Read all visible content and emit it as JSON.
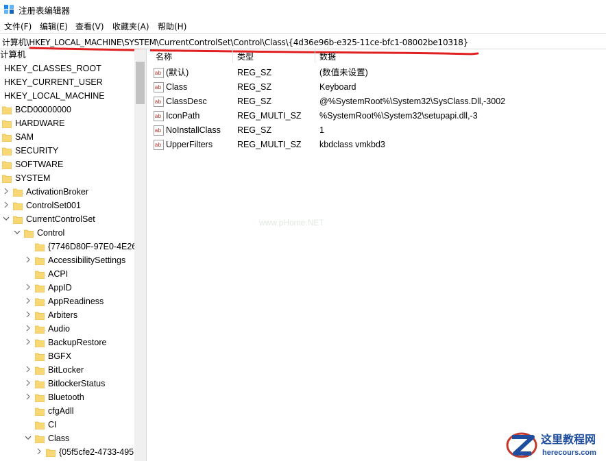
{
  "window": {
    "title": "注册表编辑器"
  },
  "menu": [
    "文件(F)",
    "编辑(E)",
    "查看(V)",
    "收藏夹(A)",
    "帮助(H)"
  ],
  "address": {
    "path": "计算机\\HKEY_LOCAL_MACHINE\\SYSTEM\\CurrentControlSet\\Control\\Class\\{4d36e96b-e325-11ce-bfc1-08002be10318}"
  },
  "tree": {
    "root": "计算机",
    "hives": [
      "HKEY_CLASSES_ROOT",
      "HKEY_CURRENT_USER",
      "HKEY_LOCAL_MACHINE"
    ],
    "hklm_children": [
      "BCD00000000",
      "HARDWARE",
      "SAM",
      "SECURITY",
      "SOFTWARE",
      "SYSTEM"
    ],
    "system_children": [
      "ActivationBroker",
      "ControlSet001",
      "CurrentControlSet"
    ],
    "ccs_children": [
      "Control"
    ],
    "control_children": [
      "{7746D80F-97E0-4E26",
      "AccessibilitySettings",
      "ACPI",
      "AppID",
      "AppReadiness",
      "Arbiters",
      "Audio",
      "BackupRestore",
      "BGFX",
      "BitLocker",
      "BitlockerStatus",
      "Bluetooth",
      "cfgAdll",
      "CI",
      "Class"
    ],
    "class_children": [
      "{05f5cfe2-4733-495"
    ]
  },
  "columns": {
    "name": "名称",
    "type": "类型",
    "data": "数据"
  },
  "values": [
    {
      "name": "(默认)",
      "type": "REG_SZ",
      "data": "(数值未设置)"
    },
    {
      "name": "Class",
      "type": "REG_SZ",
      "data": "Keyboard"
    },
    {
      "name": "ClassDesc",
      "type": "REG_SZ",
      "data": "@%SystemRoot%\\System32\\SysClass.Dll,-3002"
    },
    {
      "name": "IconPath",
      "type": "REG_MULTI_SZ",
      "data": "%SystemRoot%\\System32\\setupapi.dll,-3"
    },
    {
      "name": "NoInstallClass",
      "type": "REG_SZ",
      "data": "1"
    },
    {
      "name": "UpperFilters",
      "type": "REG_MULTI_SZ",
      "data": "kbdclass vmkbd3"
    }
  ],
  "watermark": "www.pHome.NET",
  "brand": {
    "name": "这里教程网",
    "url": "herecours.com"
  },
  "colors": {
    "folder": "#f8d775",
    "folderDark": "#e8b83a",
    "annotation": "#e02020",
    "abIcon": "#c0392b"
  }
}
